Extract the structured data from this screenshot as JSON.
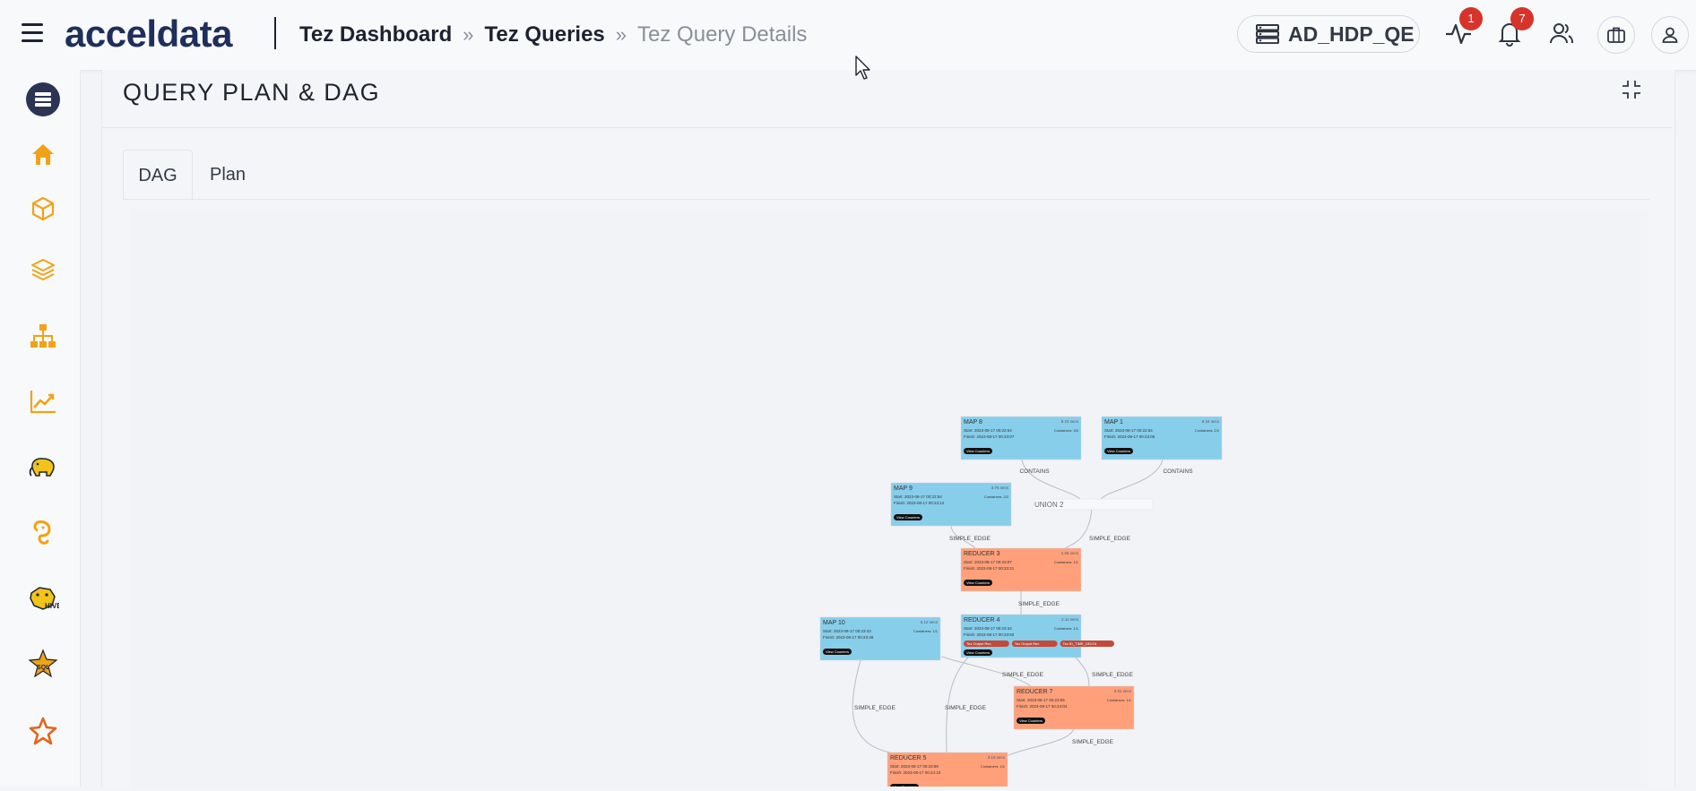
{
  "header": {
    "logo_text": "acceldata",
    "breadcrumbs": [
      "Tez Dashboard",
      "Tez Queries",
      "Tez Query Details"
    ],
    "breadcrumb_separator": "»",
    "cluster_name": "AD_HDP_QE",
    "activity_badge": "1",
    "notification_badge": "7"
  },
  "sidebar": {
    "items": [
      {
        "icon": "server-stack-icon"
      },
      {
        "icon": "home-icon"
      },
      {
        "icon": "cube-icon"
      },
      {
        "icon": "layers-icon"
      },
      {
        "icon": "hierarchy-icon"
      },
      {
        "icon": "trend-chart-icon"
      },
      {
        "icon": "hadoop-elephant-icon"
      },
      {
        "icon": "hdfs-elephant-icon"
      },
      {
        "icon": "hive-icon"
      },
      {
        "icon": "spark-icon"
      },
      {
        "icon": "star-outline-icon"
      }
    ],
    "accent_color": "#f0a317"
  },
  "panel": {
    "title": "QUERY PLAN & DAG",
    "tabs": [
      "DAG",
      "Plan"
    ],
    "active_tab": "DAG"
  },
  "dag": {
    "button_label": "View Counters",
    "colors": {
      "map": "#87ceeb",
      "reducer": "#ffa07a"
    },
    "nodes": [
      {
        "id": "MAP 8",
        "type": "map",
        "duration": "8.23 secs",
        "start": "2023-08-17 00:22:54",
        "finish": "2023-08-17 00:23:07",
        "status_label": "Containers: 3/3"
      },
      {
        "id": "MAP 1",
        "type": "map",
        "duration": "8.34 secs",
        "start": "2023-08-17 00:22:54",
        "finish": "2023-08-17 00:23:05",
        "status_label": "Containers: 2/2"
      },
      {
        "id": "MAP 9",
        "type": "map",
        "duration": "3.76 secs",
        "start": "2023-08-17 00:22:54",
        "finish": "2023-08-17 00:23:12",
        "status_label": "Containers: 2/2"
      },
      {
        "id": "REDUCER 3",
        "type": "reducer",
        "duration": "1.05 secs",
        "start": "2023-08-17 00:23:07",
        "finish": "2023-08-17 00:23:21",
        "status_label": "Containers: 1/1"
      },
      {
        "id": "REDUCER 4",
        "type": "map",
        "duration": "2.11 secs",
        "start": "2023-08-17 00:23:34",
        "finish": "2023-08-17 00:23:50",
        "status_label": "Containers: 1/1",
        "tags": [
          "Tez Output Rec",
          "Tez Output Rec",
          "Tez ID_TIME_DELTA"
        ]
      },
      {
        "id": "MAP 10",
        "type": "map",
        "duration": "5.12 secs",
        "start": "2023-08-17 00:23:43",
        "finish": "2023-08-17 00:23:48",
        "status_label": "Containers: 1/1"
      },
      {
        "id": "REDUCER 7",
        "type": "reducer",
        "duration": "2.01 secs",
        "start": "2023-08-17 00:23:55",
        "finish": "2023-08-17 00:24:03",
        "status_label": "Containers: 1/1"
      },
      {
        "id": "REDUCER 5",
        "type": "reducer",
        "duration": "3.15 secs",
        "start": "2023-08-17 00:23:59",
        "finish": "2023-08-17 00:24:10",
        "status_label": "Containers: 1/1"
      }
    ],
    "union_node": "UNION 2",
    "edges": [
      {
        "from": "MAP 8",
        "to": "UNION 2",
        "label": "CONTAINS"
      },
      {
        "from": "MAP 1",
        "to": "UNION 2",
        "label": "CONTAINS"
      },
      {
        "from": "MAP 9",
        "to": "REDUCER 3",
        "label": "SIMPLE_EDGE"
      },
      {
        "from": "UNION 2",
        "to": "REDUCER 3",
        "label": "SIMPLE_EDGE"
      },
      {
        "from": "REDUCER 3",
        "to": "REDUCER 4",
        "label": "SIMPLE_EDGE"
      },
      {
        "from": "MAP 10",
        "to": "REDUCER 7",
        "label": "SIMPLE_EDGE"
      },
      {
        "from": "REDUCER 4",
        "to": "REDUCER 7",
        "label": "SIMPLE_EDGE"
      },
      {
        "from": "MAP 10",
        "to": "REDUCER 5",
        "label": "SIMPLE_EDGE"
      },
      {
        "from": "REDUCER 4",
        "to": "REDUCER 5",
        "label": "SIMPLE_EDGE"
      },
      {
        "from": "REDUCER 7",
        "to": "REDUCER 5",
        "label": "SIMPLE_EDGE"
      }
    ]
  }
}
